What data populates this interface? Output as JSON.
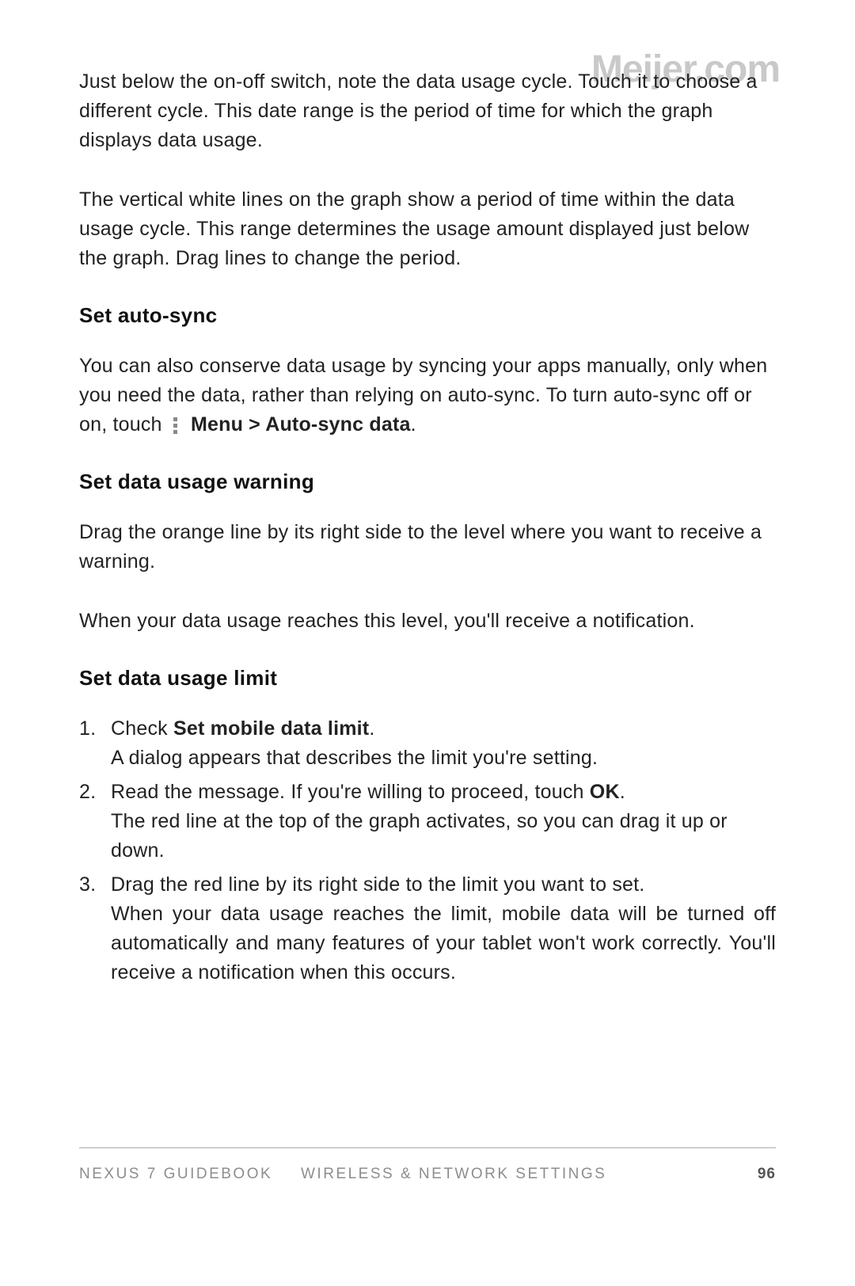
{
  "watermark": "Meijer.com",
  "paragraphs": {
    "p1": "Just below the on-off switch, note the data usage cycle. Touch it to choose a different cycle. This date range is the period of time for which the graph displays data usage.",
    "p2": "The vertical white lines on the graph show a period of time within the data usage cycle. This range determines the usage amount displayed just below the graph. Drag lines to change the period."
  },
  "sections": {
    "autosync": {
      "heading": "Set auto-sync",
      "text_before_icon": "You can also conserve data usage by syncing your apps manually, only when you need the data, rather than relying on auto-sync. To turn auto-sync off or on, touch ",
      "menu_path": "Menu > Auto-sync data",
      "period": "."
    },
    "warning": {
      "heading": "Set data usage warning",
      "p1": "Drag the orange line by its right side to the level where you want to receive a warning.",
      "p2": "When your data usage reaches this level, you'll receive a notification."
    },
    "limit": {
      "heading": "Set data usage limit",
      "steps": [
        {
          "lead": "Check ",
          "bold": "Set mobile data limit",
          "after_bold": ".",
          "body": "A dialog appears that describes the limit you're setting."
        },
        {
          "lead": "Read the message. If you're willing to proceed, touch ",
          "bold": "OK",
          "after_bold": ".",
          "body": "The red line at the top of the graph activates, so you can drag it up or down."
        },
        {
          "lead": "Drag the red line by its right side to the limit you want to set.",
          "bold": "",
          "after_bold": "",
          "body": "When your data usage reaches the limit, mobile data will be turned off automatically and many features of your tablet won't work correctly. You'll receive a notification when this occurs."
        }
      ]
    }
  },
  "footer": {
    "book": "NEXUS 7 GUIDEBOOK",
    "section": "WIRELESS & NETWORK SETTINGS",
    "page": "96"
  }
}
